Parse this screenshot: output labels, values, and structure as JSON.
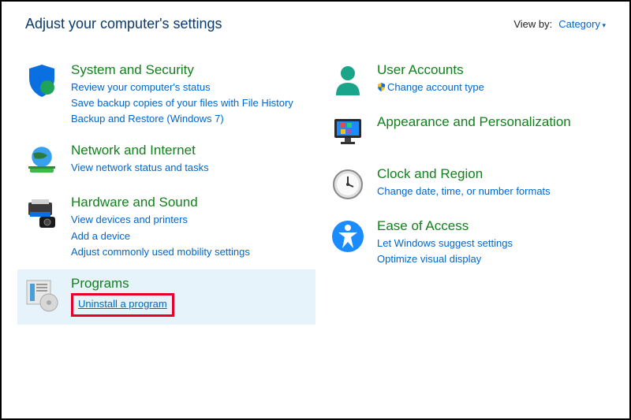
{
  "header": {
    "title": "Adjust your computer's settings",
    "viewby_label": "View by:",
    "viewby_value": "Category"
  },
  "left": [
    {
      "id": "system-security",
      "title": "System and Security",
      "links": [
        "Review your computer's status",
        "Save backup copies of your files with File History",
        "Backup and Restore (Windows 7)"
      ]
    },
    {
      "id": "network-internet",
      "title": "Network and Internet",
      "links": [
        "View network status and tasks"
      ]
    },
    {
      "id": "hardware-sound",
      "title": "Hardware and Sound",
      "links": [
        "View devices and printers",
        "Add a device",
        "Adjust commonly used mobility settings"
      ]
    },
    {
      "id": "programs",
      "title": "Programs",
      "links": [
        "Uninstall a program"
      ],
      "highlight": true
    }
  ],
  "right": [
    {
      "id": "user-accounts",
      "title": "User Accounts",
      "links": [
        "Change account type"
      ],
      "shield": true
    },
    {
      "id": "appearance",
      "title": "Appearance and Personalization",
      "links": []
    },
    {
      "id": "clock-region",
      "title": "Clock and Region",
      "links": [
        "Change date, time, or number formats"
      ]
    },
    {
      "id": "ease-of-access",
      "title": "Ease of Access",
      "links": [
        "Let Windows suggest settings",
        "Optimize visual display"
      ]
    }
  ]
}
